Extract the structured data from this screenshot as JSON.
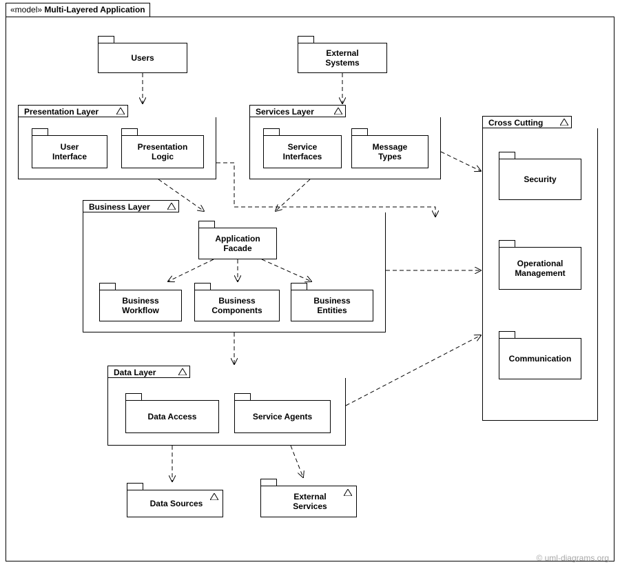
{
  "model": {
    "stereotype": "«model»",
    "title": "Multi-Layered Application"
  },
  "actors": {
    "users": "Users",
    "external_systems": "External\nSystems"
  },
  "layers": {
    "presentation": {
      "title": "Presentation Layer",
      "user_interface": "User\nInterface",
      "presentation_logic": "Presentation\nLogic"
    },
    "services": {
      "title": "Services Layer",
      "service_interfaces": "Service\nInterfaces",
      "message_types": "Message\nTypes"
    },
    "business": {
      "title": "Business Layer",
      "application_facade": "Application\nFacade",
      "business_workflow": "Business\nWorkflow",
      "business_components": "Business\nComponents",
      "business_entities": "Business\nEntities"
    },
    "data": {
      "title": "Data Layer",
      "data_access": "Data Access",
      "service_agents": "Service Agents"
    },
    "cross_cutting": {
      "title": "Cross Cutting",
      "security": "Security",
      "operational_management": "Operational\nManagement",
      "communication": "Communication"
    }
  },
  "sinks": {
    "data_sources": "Data Sources",
    "external_services": "External\nServices"
  },
  "footer": "© uml-diagrams.org"
}
